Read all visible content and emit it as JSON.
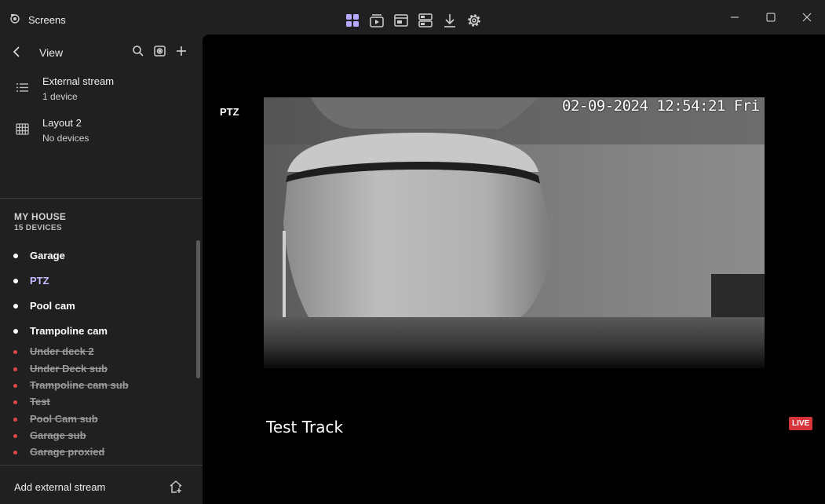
{
  "app": {
    "title": "Screens",
    "icon": "camera-app-icon"
  },
  "toolbar": {
    "icons": [
      "layout-grid-icon",
      "playback-icon",
      "window-icon",
      "split-view-icon",
      "download-icon",
      "gear-icon"
    ],
    "accent": "#b8a8ff"
  },
  "window_controls": [
    "minimize-icon",
    "maximize-icon",
    "close-icon"
  ],
  "sidebar": {
    "view_label": "View",
    "layouts": [
      {
        "name": "External stream",
        "sub": "1 device",
        "icon": "list-icon"
      },
      {
        "name": "Layout 2",
        "sub": "No devices",
        "icon": "grid-icon"
      }
    ],
    "group": {
      "title": "MY HOUSE",
      "sub": "15 DEVICES"
    },
    "devices": [
      {
        "name": "Garage",
        "status": "online"
      },
      {
        "name": "PTZ",
        "status": "selected"
      },
      {
        "name": "Pool cam",
        "status": "online"
      },
      {
        "name": "Trampoline cam",
        "status": "online"
      },
      {
        "name": "Under deck 2",
        "status": "offline"
      },
      {
        "name": "Under Deck sub",
        "status": "offline"
      },
      {
        "name": "Trampoline cam sub",
        "status": "offline"
      },
      {
        "name": "Test",
        "status": "offline"
      },
      {
        "name": "Pool Cam sub",
        "status": "offline"
      },
      {
        "name": "Garage sub",
        "status": "offline"
      },
      {
        "name": "Garage proxied",
        "status": "offline"
      }
    ],
    "add_stream_label": "Add external stream"
  },
  "viewer": {
    "tile_label": "PTZ",
    "timestamp": "02-09-2024 12:54:21 Fri",
    "overlay_title": "Test Track",
    "live_badge": "LIVE",
    "live_color": "#d4343a"
  }
}
